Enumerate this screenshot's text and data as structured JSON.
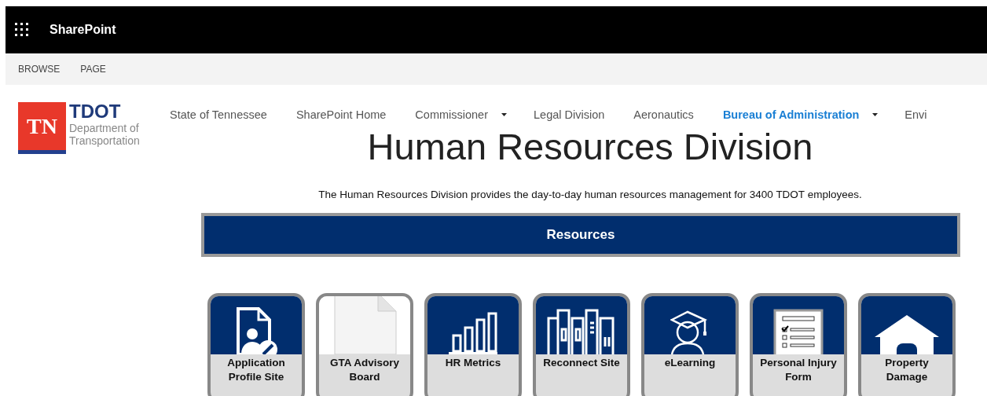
{
  "suite_bar": {
    "title": "SharePoint"
  },
  "ribbon_tabs": [
    "BROWSE",
    "PAGE"
  ],
  "logo": {
    "badge": "TN",
    "name": "TDOT",
    "subtitle_1": "Department of",
    "subtitle_2": "Transportation"
  },
  "nav": [
    {
      "label": "State of Tennessee",
      "selected": false,
      "dropdown": false
    },
    {
      "label": "SharePoint Home",
      "selected": false,
      "dropdown": false
    },
    {
      "label": "Commissioner",
      "selected": false,
      "dropdown": true
    },
    {
      "label": "Legal Division",
      "selected": false,
      "dropdown": false
    },
    {
      "label": "Aeronautics",
      "selected": false,
      "dropdown": false
    },
    {
      "label": "Bureau of Administration",
      "selected": true,
      "dropdown": true
    },
    {
      "label": "Envi",
      "selected": false,
      "dropdown": false
    }
  ],
  "page_title": "Human Resources Division",
  "description": "The Human Resources Division provides the day-to-day human resources management for 3400 TDOT employees.",
  "section_header": "Resources",
  "tiles": [
    {
      "label": "Application Profile Site",
      "kind": "profile"
    },
    {
      "label": "GTA Advisory Board",
      "kind": "blank"
    },
    {
      "label": "HR Metrics",
      "kind": "metrics"
    },
    {
      "label": "Reconnect Site",
      "kind": "books"
    },
    {
      "label": "eLearning",
      "kind": "learning"
    },
    {
      "label": "Personal Injury Form",
      "kind": "form"
    },
    {
      "label": "Property Damage",
      "kind": "house"
    }
  ]
}
